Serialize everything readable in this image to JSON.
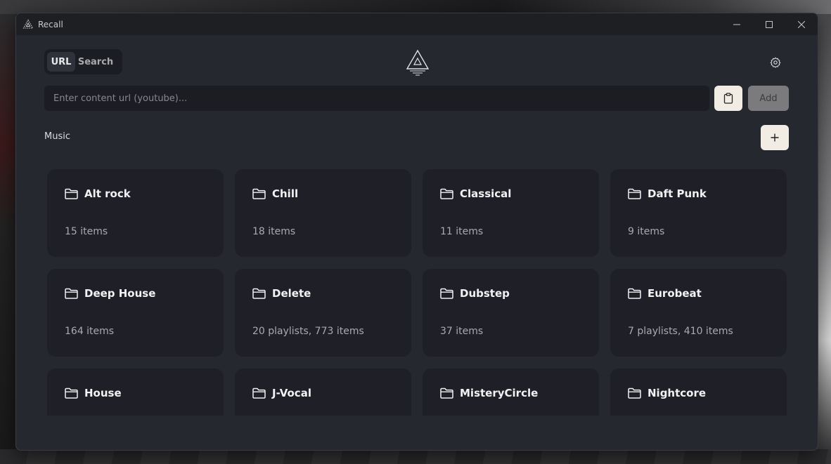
{
  "window": {
    "title": "Recall"
  },
  "mode_tabs": [
    {
      "label": "URL",
      "active": true
    },
    {
      "label": "Search",
      "active": false
    }
  ],
  "url_input": {
    "value": "",
    "placeholder": "Enter content url (youtube)..."
  },
  "toolbar": {
    "add_label": "Add",
    "paste_icon": "clipboard-icon",
    "settings_icon": "gear-icon"
  },
  "section": {
    "title": "Music",
    "new_folder_icon": "plus-icon"
  },
  "folders": [
    {
      "name": "Alt rock",
      "count": "15 items"
    },
    {
      "name": "Chill",
      "count": "18 items"
    },
    {
      "name": "Classical",
      "count": "11 items"
    },
    {
      "name": "Daft Punk",
      "count": "9 items"
    },
    {
      "name": "Deep House",
      "count": "164 items"
    },
    {
      "name": "Delete",
      "count": "20 playlists, 773 items"
    },
    {
      "name": "Dubstep",
      "count": "37 items"
    },
    {
      "name": "Eurobeat",
      "count": "7 playlists, 410 items"
    },
    {
      "name": "House",
      "count": ""
    },
    {
      "name": "J-Vocal",
      "count": ""
    },
    {
      "name": "MisteryCircle",
      "count": ""
    },
    {
      "name": "Nightcore",
      "count": ""
    }
  ],
  "colors": {
    "background": "#262830",
    "card": "#1f2027",
    "accent_button": "#f1ede4",
    "disabled_button": "#7b7b7e"
  }
}
